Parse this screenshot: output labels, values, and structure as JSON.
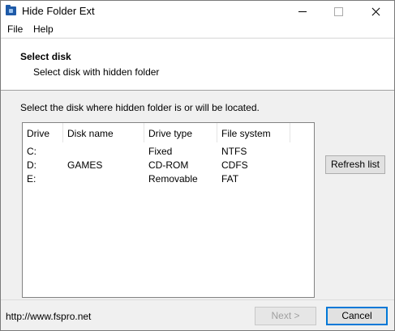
{
  "window": {
    "title": "Hide Folder Ext",
    "icon": "folder-icon"
  },
  "menu": {
    "items": [
      "File",
      "Help"
    ]
  },
  "header": {
    "title": "Select disk",
    "subtitle": "Select disk with hidden folder"
  },
  "instruction": "Select the disk where hidden folder is or will be located.",
  "disks": {
    "columns": [
      "Drive",
      "Disk name",
      "Drive type",
      "File system"
    ],
    "rows": [
      [
        "C:",
        "",
        "Fixed",
        "NTFS"
      ],
      [
        "D:",
        "GAMES",
        "CD-ROM",
        "CDFS"
      ],
      [
        "E:",
        "",
        "Removable",
        "FAT"
      ]
    ]
  },
  "buttons": {
    "refresh": "Refresh list",
    "next": "Next >",
    "cancel": "Cancel"
  },
  "footer": {
    "url": "http://www.fspro.net"
  },
  "colors": {
    "accent": "#0078d7",
    "background": "#f0f0f0"
  }
}
